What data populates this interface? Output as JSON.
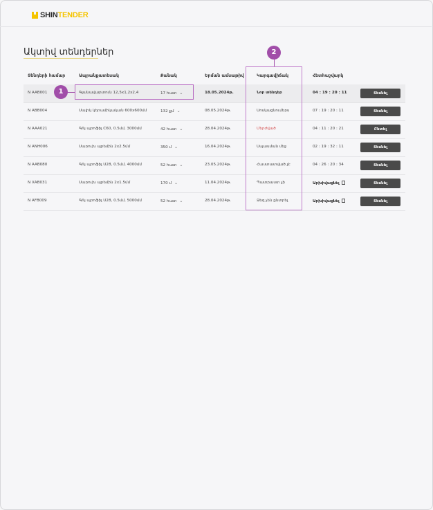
{
  "brand": {
    "part1": "SHIN",
    "part2": "TENDER"
  },
  "page_title": "Ակտիվ տենդերներ",
  "columns": [
    "Տենդերի համար",
    "Ապրանքատեսակ",
    "Քանակ",
    "Երման ամսաթիվ",
    "Կարգավիճակ",
    "Հետհաշվարկ"
  ],
  "rows": [
    {
      "id": "N AAB001",
      "product": "Գլանավարտուն 12,5x1,2x2,4",
      "qty": "17 հատ",
      "date": "18.05.2024թ.",
      "status": "Նոր տենդեր",
      "countdown": "04 : 19 : 20 : 11",
      "button": "Տեսնել"
    },
    {
      "id": "N ABB004",
      "product": "Սալիկ կերամիկական 600x600մմ",
      "qty": "132 քմ",
      "date": "08.05.2024թ.",
      "status": "Սոսկացնումերս",
      "countdown": "07 : 19 : 20 : 11",
      "button": "Տեսնել"
    },
    {
      "id": "N AAA021",
      "product": "Գ/կ պրոֆիլ C60, 0.5մմ, 3000մմ",
      "qty": "42 հատ",
      "date": "28.04.2024թ.",
      "status": "Մերժված",
      "countdown": "04 : 11 : 20 : 21",
      "button": "Ընտել"
    },
    {
      "id": "N ANH006",
      "product": "Սարուխ պրեմին 2x2.5մմ",
      "qty": "350 մ",
      "date": "16.04.2024թ.",
      "status": "Սպասման մեջ",
      "countdown": "02 : 19 : 32 : 11",
      "button": "Տեսնել"
    },
    {
      "id": "N AAB080",
      "product": "Գ/կ պրոֆիլ U28, 0.5մմ, 4000մմ",
      "qty": "52 հատ",
      "date": "23.05.2024թ.",
      "status": "Հաստատված չէ",
      "countdown": "04 : 26 : 20 : 34",
      "button": "Տեսնել"
    },
    {
      "id": "N XAB031",
      "product": "Սարուխ պրեմին 2x1.5մմ",
      "qty": "170 մ",
      "date": "11.04.2024թ.",
      "status": "Պատրաստ չի",
      "countdown": "Արխիվացնել",
      "button": "Տեսնել"
    },
    {
      "id": "N AFB009",
      "product": "Գ/կ պրոֆիլ U28, 0.5մմ, 5000մմ",
      "qty": "52 հատ",
      "date": "28.04.2024թ.",
      "status": "Ձեզ չեն ընտրել",
      "countdown": "Արխիվացնել",
      "button": "Տեսնել"
    }
  ],
  "markers": [
    "1",
    "2"
  ],
  "colors": {
    "accent": "#f5c400",
    "highlight": "#a14ea9",
    "button": "#4a4a4a",
    "rejected": "#d24b4b"
  }
}
